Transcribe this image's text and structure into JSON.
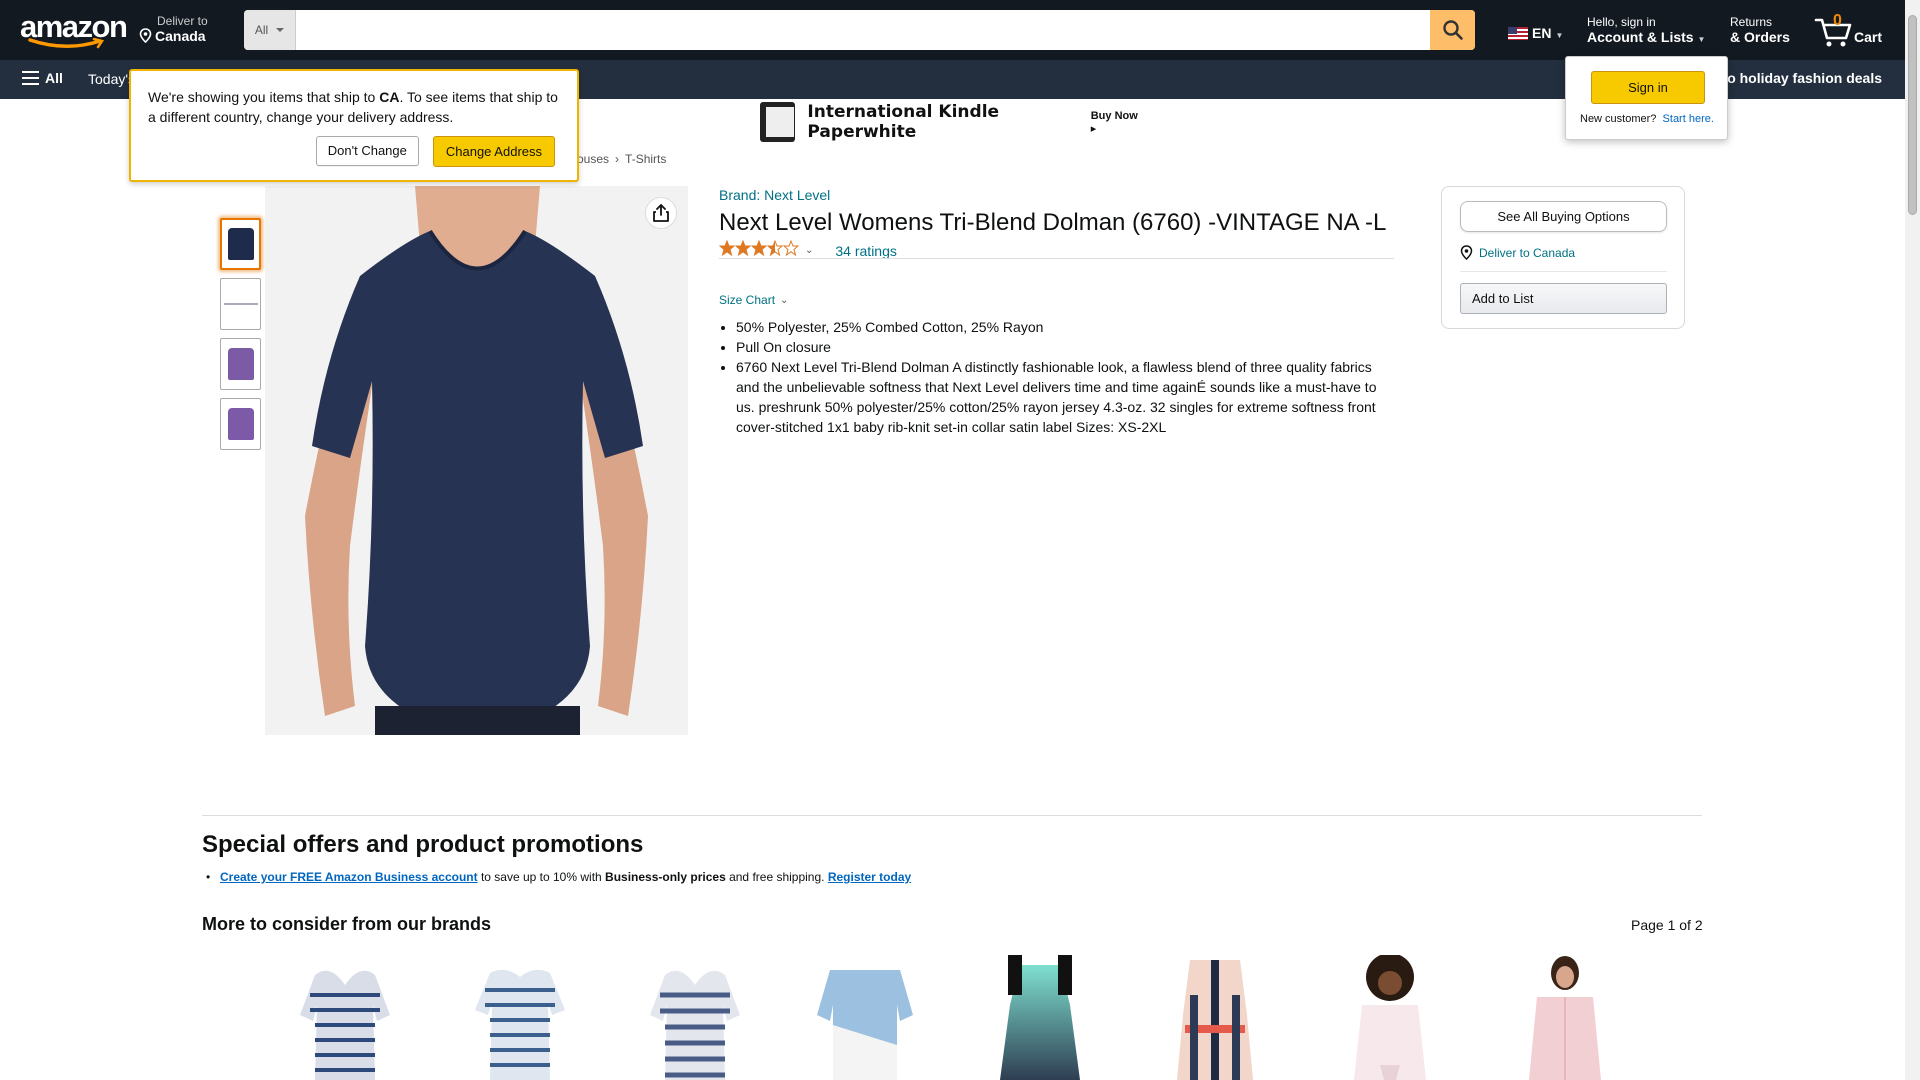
{
  "header": {
    "logo": "amazon",
    "deliver_line1": "Deliver to",
    "deliver_line2": "Canada",
    "search_category": "All",
    "search_placeholder": "",
    "lang": "EN",
    "account_line1": "Hello, sign in",
    "account_line2": "Account & Lists",
    "returns_line1": "Returns",
    "returns_line2": "& Orders",
    "cart_count": "0",
    "cart_label": "Cart"
  },
  "subnav": {
    "all_label": "All",
    "todays_label": "Today's",
    "holiday_label": "o holiday fashion deals"
  },
  "banner": {
    "title": "International Kindle Paperwhite",
    "buy_now": "Buy Now ▸"
  },
  "ship_popover": {
    "text_pre": "We're showing you items that ship to ",
    "country": "CA",
    "text_post": ". To see items that ship to a different country, change your delivery address.",
    "dont_change": "Don't Change",
    "change_address": "Change Address"
  },
  "signin_popover": {
    "button": "Sign in",
    "new_customer": "New customer?",
    "start_here": "Start here."
  },
  "breadcrumb": {
    "items": [
      "ouses",
      "›",
      "T-Shirts"
    ]
  },
  "product": {
    "brand": "Brand: Next Level",
    "title": "Next Level Womens Tri-Blend Dolman (6760) -VINTAGE NA -L",
    "rating_stars": 3.5,
    "ratings_count": "34 ratings",
    "size_chart": "Size Chart",
    "bullets": [
      "50% Polyester, 25% Combed Cotton, 25% Rayon",
      "Pull On closure",
      "6760 Next Level Tri-Blend Dolman A distinctly fashionable look, a flawless blend of three quality fabrics and the unbelievable softness that Next Level delivers time and time againÉ sounds like a must-have to us. preshrunk 50% polyester/25% cotton/25% rayon jersey 4.3-oz. 32 singles for extreme softness front cover-stitched 1x1 baby rib-knit set-in collar satin label Sizes: XS-2XL"
    ],
    "thumb_colors": [
      "#1f2b4a",
      "#ffffff",
      "#7b5aa6",
      "#7d5aa8"
    ],
    "main_color": "#263352"
  },
  "buybox": {
    "see_all": "See All Buying Options",
    "deliver": "Deliver to Canada",
    "add_to_list": "Add to List"
  },
  "offers": {
    "title": "Special offers and product promotions",
    "link1": "Create your FREE Amazon Business account",
    "text1": " to save up to 10% with ",
    "bold1": "Business-only prices",
    "text2": " and free shipping. ",
    "link2": "Register today"
  },
  "more": {
    "title": "More to consider from our brands",
    "page": "Page 1 of 2"
  },
  "colors": {
    "nav_dark": "#131921",
    "nav_sub": "#232f3e",
    "search_btn": "#febd69",
    "link": "#007185",
    "star": "#de7921",
    "yellow": "#f7ca00"
  }
}
